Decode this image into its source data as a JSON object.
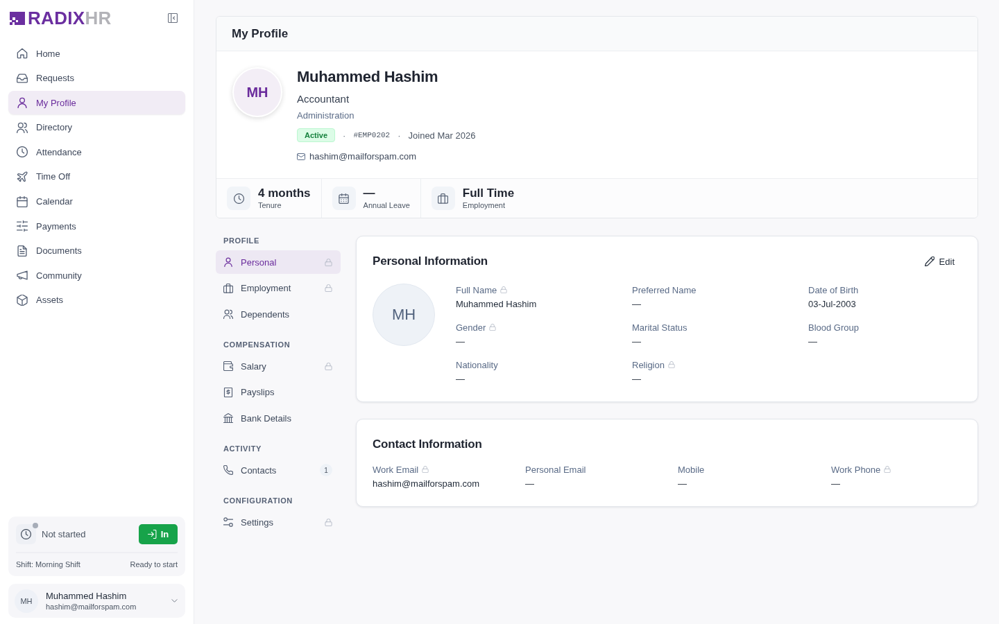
{
  "brand": {
    "name": "RADIX",
    "accent": "HR"
  },
  "sidebar": {
    "items": [
      {
        "label": "Home",
        "selected": false
      },
      {
        "label": "Requests",
        "selected": false
      },
      {
        "label": "My Profile",
        "selected": true
      },
      {
        "label": "Directory",
        "selected": false
      },
      {
        "label": "Attendance",
        "selected": false
      },
      {
        "label": "Time Off",
        "selected": false
      },
      {
        "label": "Calendar",
        "selected": false
      },
      {
        "label": "Payments",
        "selected": false
      },
      {
        "label": "Documents",
        "selected": false
      },
      {
        "label": "Community",
        "selected": false
      },
      {
        "label": "Assets",
        "selected": false
      }
    ],
    "clock": {
      "status": "Not started",
      "active": false,
      "button": "In",
      "shift": "Shift: Morning Shift",
      "note": "Ready to start"
    },
    "user": {
      "initials": "MH",
      "name": "Muhammed Hashim",
      "email": "hashim@mailforspam.com"
    }
  },
  "page": {
    "title": "My Profile"
  },
  "profile": {
    "initials": "MH",
    "name": "Muhammed Hashim",
    "job_title": "Accountant",
    "department": "Administration",
    "meta": [
      {
        "kind": "status",
        "text": "Active"
      },
      {
        "kind": "separator",
        "text": "·"
      },
      {
        "kind": "id",
        "text": "#EMP0202"
      },
      {
        "kind": "separator",
        "text": "·"
      },
      {
        "kind": "text",
        "text": "Joined Mar 2026"
      }
    ],
    "email": "hashim@mailforspam.com",
    "stats": [
      {
        "value": "4 months",
        "label": "Tenure"
      },
      {
        "value": "—",
        "label": "Annual Leave"
      },
      {
        "value": "Full Time",
        "label": "Employment"
      }
    ]
  },
  "section_nav": [
    {
      "heading": "PROFILE",
      "items": [
        {
          "label": "Personal",
          "selected": true,
          "locked": true
        },
        {
          "label": "Employment",
          "selected": false,
          "locked": true
        },
        {
          "label": "Dependents",
          "selected": false,
          "locked": false
        }
      ]
    },
    {
      "heading": "COMPENSATION",
      "items": [
        {
          "label": "Salary",
          "selected": false,
          "locked": true
        },
        {
          "label": "Payslips",
          "selected": false,
          "locked": false
        },
        {
          "label": "Bank Details",
          "selected": false,
          "locked": false
        }
      ]
    },
    {
      "heading": "ACTIVITY",
      "items": [
        {
          "label": "Contacts",
          "selected": false,
          "locked": false,
          "count": "1"
        }
      ]
    },
    {
      "heading": "CONFIGURATION",
      "items": [
        {
          "label": "Settings",
          "selected": false,
          "locked": true
        }
      ]
    }
  ],
  "personal_information": {
    "title": "Personal Information",
    "edit": "Edit",
    "initials": "MH",
    "fields": [
      {
        "label": "Full Name",
        "value": "Muhammed Hashim",
        "locked": true
      },
      {
        "label": "Preferred Name",
        "value": "—",
        "locked": false
      },
      {
        "label": "Date of Birth",
        "value": "03-Jul-2003",
        "locked": false
      },
      {
        "label": "Gender",
        "value": "—",
        "locked": true
      },
      {
        "label": "Marital Status",
        "value": "—",
        "locked": false
      },
      {
        "label": "Blood Group",
        "value": "—",
        "locked": false
      },
      {
        "label": "Nationality",
        "value": "—",
        "locked": false
      },
      {
        "label": "Religion",
        "value": "—",
        "locked": true
      }
    ]
  },
  "contact_information": {
    "title": "Contact Information",
    "fields": [
      {
        "label": "Work Email",
        "value": "hashim@mailforspam.com",
        "locked": true
      },
      {
        "label": "Personal Email",
        "value": "—",
        "locked": false
      },
      {
        "label": "Mobile",
        "value": "—",
        "locked": false
      },
      {
        "label": "Work Phone",
        "value": "—",
        "locked": true
      }
    ]
  }
}
